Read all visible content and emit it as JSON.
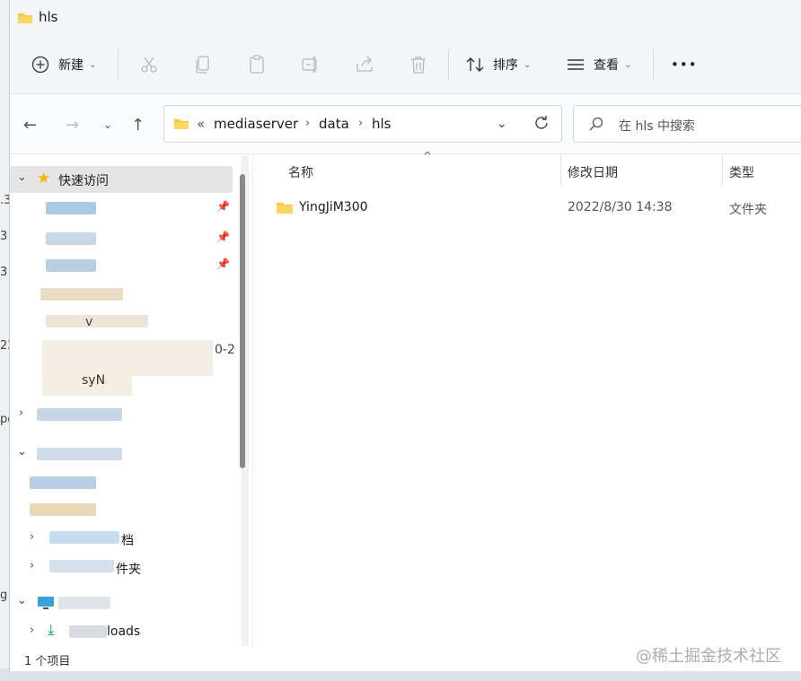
{
  "window": {
    "title": "hls"
  },
  "toolbar": {
    "new_label": "新建",
    "sort_label": "排序",
    "view_label": "查看",
    "more_label": "•••"
  },
  "address": {
    "overflow": "«",
    "crumbs": [
      "mediaserver",
      "data",
      "hls"
    ]
  },
  "search": {
    "placeholder": "在 hls 中搜索"
  },
  "navpane": {
    "quick_access_label": "快速访问",
    "partial_items": [
      {
        "text": "v"
      },
      {
        "text": "0-2"
      },
      {
        "text": "syN"
      },
      {
        "text": "档"
      },
      {
        "text": "件夹"
      },
      {
        "text": "loads"
      }
    ]
  },
  "filelist": {
    "columns": {
      "name": "名称",
      "date": "修改日期",
      "type": "类型"
    },
    "rows": [
      {
        "name": "YingJiM300",
        "date": "2022/8/30 14:38",
        "type": "文件夹"
      }
    ]
  },
  "status": {
    "item_count": "1 个项目"
  },
  "watermark": "@稀土掘金技术社区",
  "background_fragments": [
    ".3",
    "3",
    "3",
    "22",
    "pc",
    "g"
  ]
}
